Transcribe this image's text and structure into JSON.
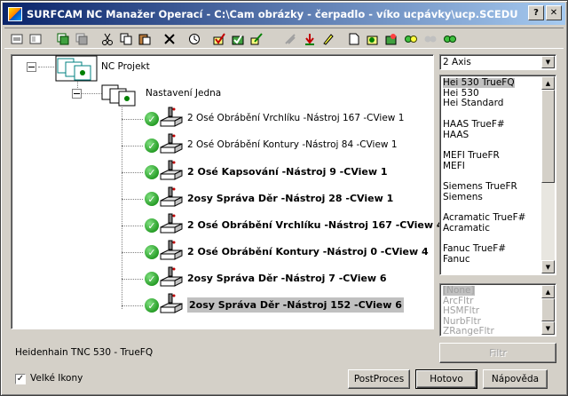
{
  "window": {
    "title": "SURFCAM NC Manažer Operací - C:\\Cam obrázky - čerpadlo - víko ucpávky\\ucp.SCEDU"
  },
  "titlebar_buttons": {
    "help": "?",
    "close": "✕"
  },
  "toolbar": {
    "tools": [
      {
        "name": "new-icon"
      },
      {
        "name": "add-icon"
      },
      {
        "name": "copy-setup-icon"
      },
      {
        "name": "paste-setup-icon"
      },
      {
        "name": "cut-icon"
      },
      {
        "name": "copy-icon"
      },
      {
        "name": "paste-icon"
      },
      {
        "name": "delete-icon"
      },
      {
        "name": "time-icon"
      },
      {
        "name": "verify-icon"
      },
      {
        "name": "post-icon"
      },
      {
        "name": "edit-icon"
      },
      {
        "name": "disabled-tool-icon"
      },
      {
        "name": "down-arrow-icon"
      },
      {
        "name": "pencil-icon"
      },
      {
        "name": "document-icon"
      },
      {
        "name": "gear-icon"
      },
      {
        "name": "flag-icon"
      },
      {
        "name": "circle-green-icon"
      },
      {
        "name": "circle-grey-icon"
      },
      {
        "name": "circles-icon"
      }
    ]
  },
  "tree": {
    "root": {
      "label": "NC Projekt"
    },
    "setup": {
      "label": "Nastavení Jedna"
    },
    "operations": [
      {
        "label": "2 Osé Obrábění Vrchlíku  -Nástroj 167 -CView 1",
        "bold": false,
        "selected": false
      },
      {
        "label": "2 Osé Obrábění Kontury  -Nástroj 84 -CView 1",
        "bold": false,
        "selected": false
      },
      {
        "label": "2 Osé Kapsování  -Nástroj 9 -CView 1",
        "bold": true,
        "selected": false
      },
      {
        "label": "2osy Správa Děr  -Nástroj 28 -CView 1",
        "bold": true,
        "selected": false
      },
      {
        "label": "2 Osé Obrábění Vrchlíku  -Nástroj 167 -CView 4",
        "bold": true,
        "selected": false
      },
      {
        "label": "2 Osé Obrábění Kontury  -Nástroj 0 -CView 4",
        "bold": true,
        "selected": false
      },
      {
        "label": "2osy Správa Děr  -Nástroj 7 -CView 6",
        "bold": true,
        "selected": false
      },
      {
        "label": "2osy Správa Děr  -Nástroj 152 -CView 6",
        "bold": true,
        "selected": true
      }
    ]
  },
  "axis_combo": {
    "value": "2 Axis"
  },
  "post_list": {
    "items": [
      {
        "label": "Hei 530 TrueFQ",
        "selected": true
      },
      {
        "label": "Hei 530",
        "selected": false
      },
      {
        "label": "Hei Standard",
        "selected": false
      },
      {
        "label": "",
        "selected": false
      },
      {
        "label": "HAAS TrueF#",
        "selected": false
      },
      {
        "label": "HAAS",
        "selected": false
      },
      {
        "label": "",
        "selected": false
      },
      {
        "label": "MEFI TrueFR",
        "selected": false
      },
      {
        "label": "MEFI",
        "selected": false
      },
      {
        "label": "",
        "selected": false
      },
      {
        "label": "Siemens TrueFR",
        "selected": false
      },
      {
        "label": "Siemens",
        "selected": false
      },
      {
        "label": "",
        "selected": false
      },
      {
        "label": "Acramatic TrueF#",
        "selected": false
      },
      {
        "label": "Acramatic",
        "selected": false
      },
      {
        "label": "",
        "selected": false
      },
      {
        "label": "Fanuc TrueF#",
        "selected": false
      },
      {
        "label": "Fanuc",
        "selected": false
      }
    ]
  },
  "filter_list": {
    "items": [
      {
        "label": "[None]",
        "selected": true
      },
      {
        "label": "ArcFltr",
        "selected": false
      },
      {
        "label": "HSMFltr",
        "selected": false
      },
      {
        "label": "NurbFltr",
        "selected": false
      },
      {
        "label": "ZRangeFltr",
        "selected": false
      }
    ]
  },
  "status": {
    "post_name": "Heidenhain TNC 530 - TrueFQ"
  },
  "buttons": {
    "filter": "Filtr",
    "postproces": "PostProces",
    "done": "Hotovo",
    "help": "Nápověda"
  },
  "large_icons": {
    "label": "Velké Ikony",
    "checked": "✓"
  },
  "colors": {
    "title_start": "#0a246a",
    "title_end": "#a6caf0",
    "check_green": "#008000"
  }
}
